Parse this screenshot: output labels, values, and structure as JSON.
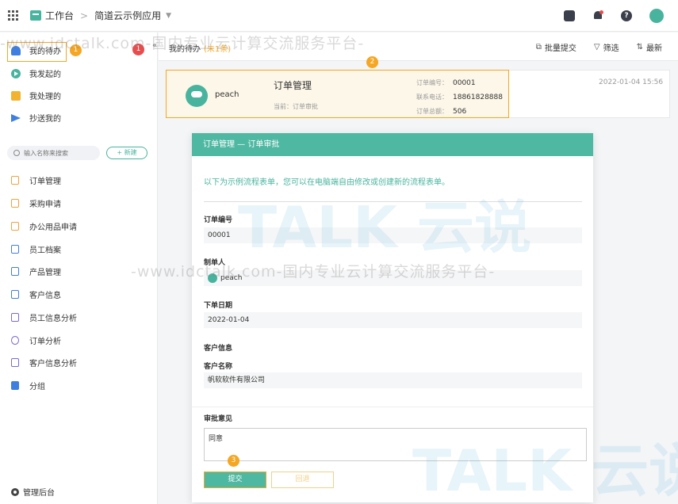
{
  "topbar": {
    "workspace_label": "工作台",
    "separator": ">",
    "app_name": "简道云示例应用",
    "help_icon_text": "?"
  },
  "watermark": {
    "site_text": "-www.idctalk.com-国内专业云计算交流服务平台-",
    "brand_text": "TALK 云说"
  },
  "sidebar": {
    "badge_count": "1",
    "step_marker_1": "1",
    "collapse_glyph": "«",
    "quick_items": [
      {
        "label": "我的待办"
      },
      {
        "label": "我发起的"
      },
      {
        "label": "我处理的"
      },
      {
        "label": "抄送我的"
      }
    ],
    "search_placeholder": "输入名称来搜索",
    "new_button_label": "+ 新建",
    "menu_items": [
      {
        "label": "订单管理"
      },
      {
        "label": "采购申请"
      },
      {
        "label": "办公用品申请"
      },
      {
        "label": "员工档案"
      },
      {
        "label": "产品管理"
      },
      {
        "label": "客户信息"
      },
      {
        "label": "员工信息分析"
      },
      {
        "label": "订单分析"
      },
      {
        "label": "客户信息分析"
      },
      {
        "label": "分组"
      }
    ],
    "admin_label": "管理后台"
  },
  "main": {
    "title": "我的待办",
    "subtitle": "(未1条)",
    "actions": {
      "batch_submit": "批量提交",
      "filter": "筛选",
      "latest": "最新"
    },
    "step_marker_2": "2",
    "card": {
      "user": "peach",
      "title": "订单管理",
      "current_label": "当前：订单审批",
      "fields": [
        {
          "key": "订单编号：",
          "value": "00001"
        },
        {
          "key": "联系电话：",
          "value": "18861828888"
        },
        {
          "key": "订单总额：",
          "value": "506"
        }
      ],
      "date": "2022-01-04 15:56"
    }
  },
  "modal": {
    "header": "订单管理 — 订单审批",
    "tip": "以下为示例流程表单，您可以在电脑端自由修改或创建新的流程表单。",
    "order_no_label": "订单编号",
    "order_no_value": "00001",
    "creator_label": "制单人",
    "creator_value": "peach",
    "date_label": "下单日期",
    "date_value": "2022-01-04",
    "customer_section": "客户信息",
    "customer_name_label": "客户名称",
    "customer_name_value": "帆软软件有限公司",
    "approval_label": "审批意见",
    "approval_value": "同意",
    "step_marker_3": "3",
    "submit_label": "提交",
    "back_label": "回退"
  },
  "colors": {
    "brand_green": "#48b49e",
    "highlight_orange": "#f5a623",
    "badge_red": "#e84d4d"
  }
}
